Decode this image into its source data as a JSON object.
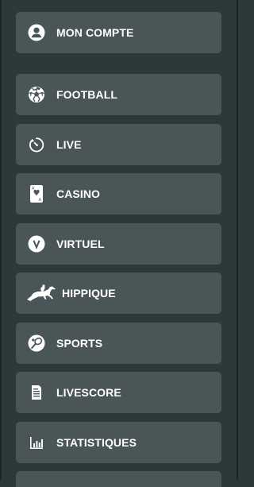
{
  "menu": {
    "items": [
      {
        "id": "account",
        "label": "MON COMPTE",
        "icon": "user-circle-icon"
      },
      {
        "id": "football",
        "label": "FOOTBALL",
        "icon": "soccer-ball-icon"
      },
      {
        "id": "live",
        "label": "LIVE",
        "icon": "stopwatch-icon"
      },
      {
        "id": "casino",
        "label": "CASINO",
        "icon": "playing-card-icon"
      },
      {
        "id": "virtuel",
        "label": "VIRTUEL",
        "icon": "v-circle-icon"
      },
      {
        "id": "hippique",
        "label": "HIPPIQUE",
        "icon": "horse-racing-icon"
      },
      {
        "id": "sports",
        "label": "SPORTS",
        "icon": "tennis-ball-racket-icon"
      },
      {
        "id": "livescore",
        "label": "LIVESCORE",
        "icon": "document-icon"
      },
      {
        "id": "statistiques",
        "label": "STATISTIQUES",
        "icon": "bar-chart-icon"
      }
    ]
  },
  "colors": {
    "background": "#2c3839",
    "item_background": "#4a5557",
    "text": "#ffffff"
  }
}
